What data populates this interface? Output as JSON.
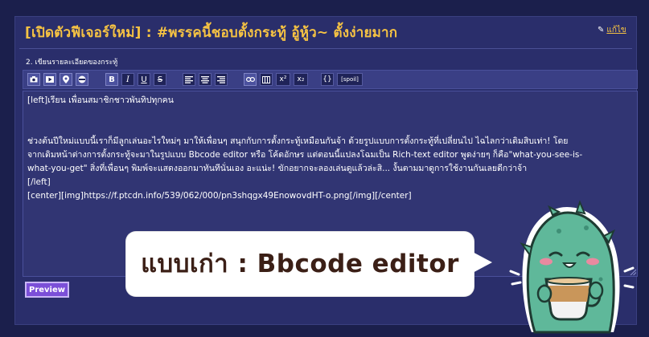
{
  "header": {
    "title": "[เปิดตัวฟีเจอร์ใหม่] : #พรรคนี้ชอบตั้งกระทู้ อู้หู้ว~ ตั้งง่ายมาก",
    "edit_label": "แก้ไข"
  },
  "form": {
    "section_label": "2. เขียนรายละเอียดของกระทู้",
    "toolbar": {
      "buttons": [
        "image-icon",
        "video-icon",
        "map-pin-icon",
        "emoji-icon",
        "B",
        "I",
        "U",
        "S",
        "align-left-icon",
        "align-center-icon",
        "align-right-icon",
        "link-icon",
        "table-icon",
        "x²",
        "x₂",
        "{}",
        "[spoil]"
      ]
    },
    "editor_lines": [
      "[left]เรียน เพื่อนสมาชิกชาวพันทิปทุกคน",
      "ช่วงต้นปีใหม่แบบนี้เราก็มีลูกเล่นอะไรใหม่ๆ มาให้เพื่อนๆ สนุกกับการตั้งกระทู้เหมือนกันจ้า ด้วยรูปแบบการตั้งกระทู้ที่เปลี่ยนไป ไฉไลกว่าเดิมสิบเท่า! โดย",
      "จากเดิมหน้าต่างการตั้งกระทู้จะมาในรูปแบบ Bbcode editor หรือ โค้ดอักษร แต่ตอนนี้แปลงโฉมเป็น Rich-text editor พูดง่ายๆ ก็คือ\"what-you-see-is-",
      "what-you-get\" สิ่งที่เพื่อนๆ พิมพ์จะแสดงออกมาทันทีนั่นเอง อะแน่ะ! ขักอยากจะลองเล่นดูแล้วล่ะสิ... งั้นตามมาดูการใช้งานกันเลยดีกว่าจ้า",
      "[/left]",
      "[center][img]https://f.ptcdn.info/539/062/000/pn3shqgx49EnowovdHT-o.png[/img][/center]"
    ],
    "preview_label": "Preview"
  },
  "callout": {
    "text": "แบบเก่า : Bbcode editor"
  },
  "colors": {
    "background": "#1b1f4c",
    "panel": "#2a2e6b",
    "title": "#f6c343",
    "preview_button": "#7b4fd8",
    "mascot": "#5fb89a"
  }
}
